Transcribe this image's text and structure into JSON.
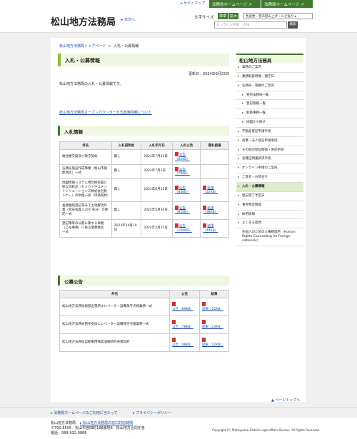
{
  "topbar": {
    "sitemap": "▸ サイトマップ",
    "tab1": "法務省ホームページ ↗",
    "tab2": "法務局ホームページ ↗"
  },
  "header": {
    "title": "松山地方法務局",
    "reading": "▸ 本文へ",
    "fontsize_label": "文字サイズ",
    "font_standard": "標準",
    "font_large": "拡大",
    "color_btn": "色変更・音声読み上げ・ルビ振り ▸",
    "search_placeholder": "オンライン申請　 方法",
    "search_button": "検索"
  },
  "breadcrumb": {
    "home": "松山地方法務局トップページ",
    "sep": ">",
    "current": "入札・公募情報"
  },
  "page_heading": "入札・公募情報",
  "updated": "更新日：2024年6月25日",
  "intro": "松山地方法務局の入札・公募情報です。",
  "counter_link": "松山地方法務局オープンカウンター方式案簿情報について",
  "section1": {
    "heading": "入札情報",
    "headers": [
      "件名",
      "入札説明会",
      "入札年月日",
      "入札公告",
      "開札結果"
    ],
    "rows": [
      {
        "name": "複合機交換及び保守契約",
        "briefing": "無し",
        "date": "2024年7月31日",
        "notice": "公告（82KB）",
        "result": ""
      },
      {
        "name": "法務局施設作成事業（松山市雄郡地区）一式",
        "briefing": "無し",
        "date": "2024年7月1日",
        "notice": "公告（79KB）",
        "result": ""
      },
      {
        "name": "地図情報システム用印刷装置に係る消耗品（セシカドキュメントソリューションズ株式会社製トナー）の供給一式（単価契約）",
        "briefing": "無し",
        "date": "2024年6月12日",
        "notice": "公告（84KB）",
        "result": "結果（22KB）"
      },
      {
        "name": "長期相続登記等未了土地解消作業（登記名義人20０名分）の委託一式",
        "briefing": "無し",
        "date": "2024年5月30日",
        "notice": "公告（85KB）",
        "result": "結果（38KB）"
      },
      {
        "name": "登記簿等の公開に関する事務（乙号事務）に係る業務委託　一式",
        "briefing": "2023年10月19日",
        "date": "2024年2月15日",
        "notice": "公告（100KB）",
        "result": "結果（44KB）"
      }
    ]
  },
  "section2": {
    "heading": "公募公告",
    "headers": [
      "件名",
      "公告",
      "結果"
    ],
    "rows": [
      {
        "name": "松山地方法務局総部出張所エレベーター設備保守点検業務一式",
        "notice": "公告（69KB）",
        "result": "結果（22KB）"
      },
      {
        "name": "松山地方法務局西条支局エレベーター設備保守点検業務一式",
        "notice": "公告（78KB）",
        "result": "結果（23KB）"
      },
      {
        "name": "松山地方法務局自動車用揮発油継続的売買契約",
        "notice": "公告（48KB）",
        "result": "結果（22KB）"
      }
    ]
  },
  "sidebar": {
    "title": "松山地方法務局",
    "items": [
      {
        "label": "業務のご案内",
        "sub": false,
        "active": false
      },
      {
        "label": "業務取扱時間・閉庁日",
        "sub": false,
        "active": false
      },
      {
        "label": "法務局・管轄のご案内",
        "sub": false,
        "active": false
      },
      {
        "label": "管内法務局一覧",
        "sub": true,
        "active": false
      },
      {
        "label": "登記管轄一覧",
        "sub": true,
        "active": false
      },
      {
        "label": "取扱事務一覧",
        "sub": true,
        "active": false
      },
      {
        "label": "地図から探す",
        "sub": true,
        "active": false
      },
      {
        "label": "不動産登記申請手続",
        "sub": false,
        "active": false
      },
      {
        "label": "商業・法人登記申請手続",
        "sub": false,
        "active": false
      },
      {
        "label": "その他の登記関係・供託手続",
        "sub": false,
        "active": false
      },
      {
        "label": "各種証明書請求手続",
        "sub": false,
        "active": false
      },
      {
        "label": "オンライン申請のご案内",
        "sub": false,
        "active": false
      },
      {
        "label": "ご意見・お問合せ",
        "sub": false,
        "active": false
      },
      {
        "label": "入札・公募情報",
        "sub": false,
        "active": true
      },
      {
        "label": "登記完了予定日",
        "sub": false,
        "active": false
      },
      {
        "label": "事界特定情報",
        "sub": false,
        "active": false
      },
      {
        "label": "採用情報",
        "sub": false,
        "active": false
      },
      {
        "label": "よくある質問",
        "sub": false,
        "active": false
      },
      {
        "label": "外国人のための人権相談所（Human Rights Counselling for Foreign nationals）",
        "sub": false,
        "active": false,
        "noarrow": true
      }
    ]
  },
  "pagetop": "▲ ページトップへ",
  "footer_links": {
    "usage": "▸ 法務局ホームページのご利用に当たって",
    "privacy": "▸ プライバシーポリシー"
  },
  "footer": {
    "name": "松山地方法務局",
    "link": "▸ 松山地方法務局の窓口対応時間",
    "address": "〒790-8505　松山市宮田町188番地6　松山地方合同庁舎",
    "tel": "電話：089-932-0888",
    "copyright": "Copyright (C) Matsuyama District Legal Affairs Bureau. All Rights Reserved."
  }
}
